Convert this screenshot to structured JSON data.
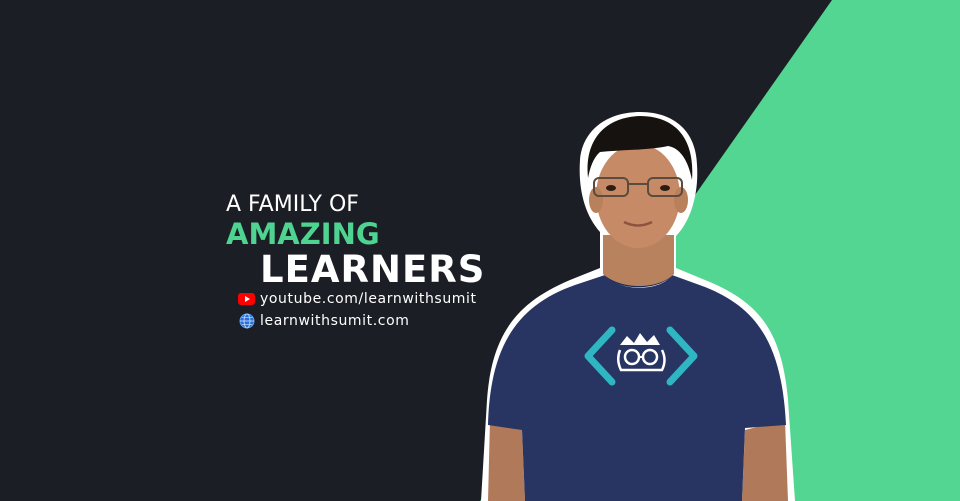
{
  "banner": {
    "tagline": {
      "line1": "A FAMILY OF",
      "line2": "AMAZING",
      "line3": "LEARNERS"
    },
    "links": [
      {
        "icon": "youtube-icon",
        "text": "youtube.com/learnwithsumit"
      },
      {
        "icon": "globe-icon",
        "text": "learnwithsumit.com"
      }
    ]
  },
  "colors": {
    "background": "#1c1e25",
    "accent": "#4ed391",
    "shirt": "#27325e",
    "logo": "#2fb6c3"
  }
}
